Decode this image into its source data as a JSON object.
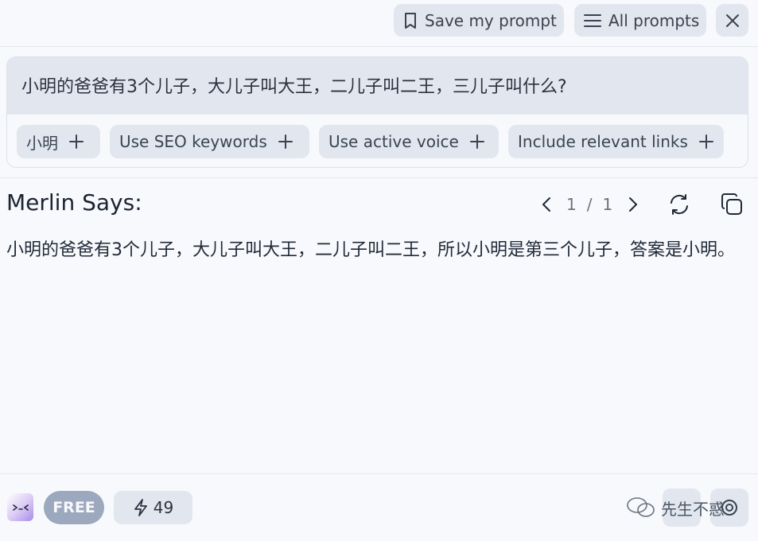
{
  "toolbar": {
    "save_label": "Save my prompt",
    "all_prompts_label": "All prompts"
  },
  "prompt": {
    "text": "小明的爸爸有3个儿子，大儿子叫大王，二儿子叫二王，三儿子叫什么?",
    "chips": [
      {
        "label": "小明"
      },
      {
        "label": "Use SEO keywords"
      },
      {
        "label": "Use active voice"
      },
      {
        "label": "Include relevant links"
      }
    ]
  },
  "response": {
    "title": "Merlin Says:",
    "pager": {
      "current": "1",
      "separator": "/",
      "total": "1"
    },
    "body": "小明的爸爸有3个儿子，大儿子叫大王，二儿子叫二王，所以小明是第三个儿子，答案是小明。"
  },
  "footer": {
    "plan_badge": "FREE",
    "credits": "49",
    "watermark": "先生不惑"
  },
  "icons": {
    "save": "bookmark-icon",
    "all_prompts": "menu-icon",
    "close": "close-icon",
    "add": "plus-icon",
    "prev": "chevron-left-icon",
    "next": "chevron-right-icon",
    "regenerate": "refresh-icon",
    "copy": "copy-icon",
    "credits": "lightning-icon",
    "logo": "merlin-logo-icon",
    "watermark": "wechat-icon"
  },
  "colors": {
    "background": "#f8f9fc",
    "button_bg": "#e2e7ef",
    "badge_bg": "#9ca8bd",
    "text": "#1f2937"
  }
}
